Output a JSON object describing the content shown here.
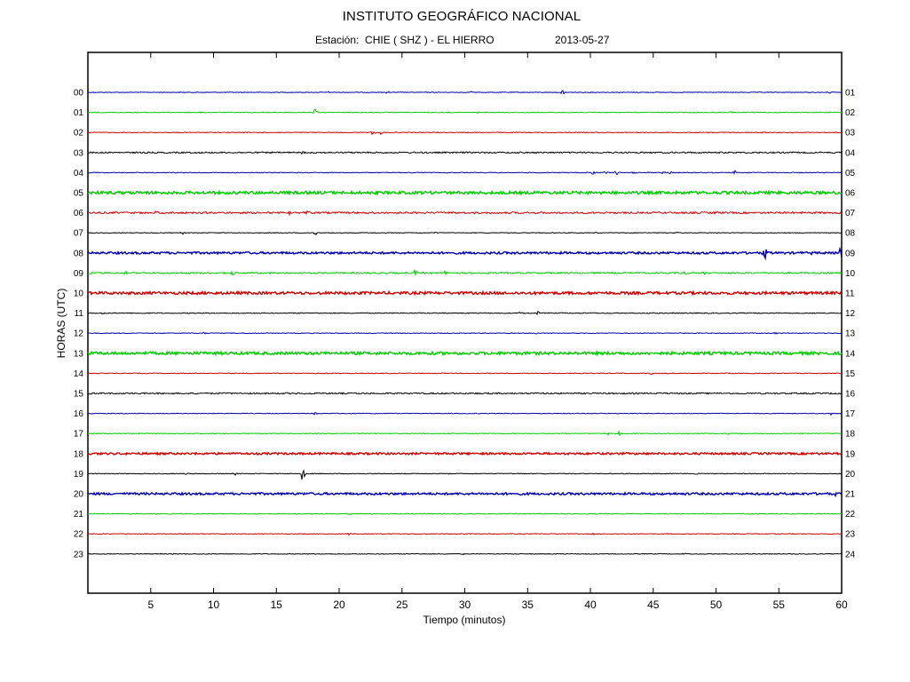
{
  "chart_data": {
    "type": "line",
    "title": "INSTITUTO GEOGRÁFICO NACIONAL",
    "subtitle_station_label": "Estación:",
    "subtitle_station": "CHIE ( SHZ ) - EL HIERRO",
    "subtitle_date": "2013-05-27",
    "xlabel": "Tiempo (minutos)",
    "ylabel": "HORAS (UTC)",
    "xlim": [
      0,
      60
    ],
    "x_ticks": [
      "5",
      "10",
      "15",
      "20",
      "25",
      "30",
      "35",
      "40",
      "45",
      "50",
      "55",
      "60"
    ],
    "grid": false,
    "legend": "none",
    "series": [
      {
        "left_label": "00",
        "right_label": "01",
        "color": "#0000aa",
        "noise": 0.4,
        "events": [
          {
            "t": 37.8,
            "amp": 3
          },
          {
            "t": 19.2,
            "amp": 1.5
          },
          {
            "t": 23.8,
            "amp": 1.5
          },
          {
            "t": 30.5,
            "amp": 1.2
          },
          {
            "t": 59,
            "amp": 1.5
          }
        ]
      },
      {
        "left_label": "01",
        "right_label": "02",
        "color": "#00cc00",
        "noise": 0.4,
        "events": [
          {
            "t": 18.1,
            "amp": 4
          },
          {
            "t": 9.0,
            "amp": 1
          },
          {
            "t": 31.0,
            "amp": 1
          },
          {
            "t": 51.2,
            "amp": 1
          }
        ]
      },
      {
        "left_label": "02",
        "right_label": "03",
        "color": "#cc0000",
        "noise": 0.4,
        "events": [
          {
            "t": 22.7,
            "amp": 4
          },
          {
            "t": 23.3,
            "amp": 2
          },
          {
            "t": 53.8,
            "amp": 1
          }
        ]
      },
      {
        "left_label": "03",
        "right_label": "04",
        "color": "#000000",
        "noise": 0.8,
        "events": [
          {
            "t": 17.1,
            "amp": 2
          }
        ]
      },
      {
        "left_label": "04",
        "right_label": "05",
        "color": "#0000aa",
        "noise": 0.4,
        "events": [
          {
            "t": 40.2,
            "amp": 2.5
          },
          {
            "t": 41.2,
            "amp": 2
          },
          {
            "t": 42.1,
            "amp": 2.5
          },
          {
            "t": 43.5,
            "amp": 2
          },
          {
            "t": 44.8,
            "amp": 2
          },
          {
            "t": 45.9,
            "amp": 2.5
          },
          {
            "t": 46.4,
            "amp": 2
          },
          {
            "t": 51.5,
            "amp": 2
          },
          {
            "t": 58.9,
            "amp": 1.5
          }
        ]
      },
      {
        "left_label": "05",
        "right_label": "06",
        "color": "#00cc00",
        "noise": 1.6,
        "events": []
      },
      {
        "left_label": "06",
        "right_label": "07",
        "color": "#cc0000",
        "noise": 1.0,
        "events": [
          {
            "t": 5.5,
            "amp": 1.5
          },
          {
            "t": 16.0,
            "amp": 1.5
          },
          {
            "t": 17.5,
            "amp": 1.5
          },
          {
            "t": 50.0,
            "amp": 1.5
          }
        ]
      },
      {
        "left_label": "07",
        "right_label": "08",
        "color": "#000000",
        "noise": 0.4,
        "events": [
          {
            "t": 18.1,
            "amp": 3
          },
          {
            "t": 7.5,
            "amp": 1.5
          },
          {
            "t": 27.7,
            "amp": 1.2
          },
          {
            "t": 40.5,
            "amp": 1.2
          },
          {
            "t": 47.0,
            "amp": 1.2
          }
        ]
      },
      {
        "left_label": "08",
        "right_label": "09",
        "color": "#0000aa",
        "noise": 1.2,
        "events": [
          {
            "t": 53.9,
            "amp": 7
          },
          {
            "t": 48.5,
            "amp": 2.5
          },
          {
            "t": 57.5,
            "amp": 2
          },
          {
            "t": 59.95,
            "amp": 8
          }
        ]
      },
      {
        "left_label": "09",
        "right_label": "10",
        "color": "#00cc00",
        "noise": 0.8,
        "events": [
          {
            "t": 3.0,
            "amp": 3
          },
          {
            "t": 11.5,
            "amp": 3
          },
          {
            "t": 26.0,
            "amp": 4
          },
          {
            "t": 28.5,
            "amp": 3
          },
          {
            "t": 47.5,
            "amp": 2.5
          },
          {
            "t": 49.0,
            "amp": 2.5
          }
        ]
      },
      {
        "left_label": "10",
        "right_label": "11",
        "color": "#cc0000",
        "noise": 1.5,
        "events": []
      },
      {
        "left_label": "11",
        "right_label": "12",
        "color": "#000000",
        "noise": 0.5,
        "events": [
          {
            "t": 34.5,
            "amp": 2
          },
          {
            "t": 35.8,
            "amp": 2
          },
          {
            "t": 3.8,
            "amp": 1.5
          },
          {
            "t": 1.2,
            "amp": 1.5
          }
        ]
      },
      {
        "left_label": "12",
        "right_label": "13",
        "color": "#0000aa",
        "noise": 0.4,
        "events": [
          {
            "t": 9.2,
            "amp": 2
          },
          {
            "t": 35.7,
            "amp": 2
          },
          {
            "t": 54.8,
            "amp": 1.5
          }
        ]
      },
      {
        "left_label": "13",
        "right_label": "14",
        "color": "#00cc00",
        "noise": 1.6,
        "events": []
      },
      {
        "left_label": "14",
        "right_label": "15",
        "color": "#cc0000",
        "noise": 0.4,
        "events": [
          {
            "t": 44.8,
            "amp": 2
          }
        ]
      },
      {
        "left_label": "15",
        "right_label": "16",
        "color": "#000000",
        "noise": 0.8,
        "events": []
      },
      {
        "left_label": "16",
        "right_label": "17",
        "color": "#0000aa",
        "noise": 0.4,
        "events": [
          {
            "t": 18.1,
            "amp": 2
          },
          {
            "t": 59.2,
            "amp": 2
          }
        ]
      },
      {
        "left_label": "17",
        "right_label": "18",
        "color": "#00cc00",
        "noise": 0.4,
        "events": [
          {
            "t": 42.3,
            "amp": 2.5
          },
          {
            "t": 41.4,
            "amp": 1.5
          },
          {
            "t": 20.2,
            "amp": 1
          },
          {
            "t": 51.0,
            "amp": 1.5
          }
        ]
      },
      {
        "left_label": "18",
        "right_label": "19",
        "color": "#cc0000",
        "noise": 1.1,
        "events": []
      },
      {
        "left_label": "19",
        "right_label": "20",
        "color": "#000000",
        "noise": 0.4,
        "events": [
          {
            "t": 17.1,
            "amp": 9
          },
          {
            "t": 7.8,
            "amp": 1.5
          },
          {
            "t": 11.7,
            "amp": 1.5
          },
          {
            "t": 48.5,
            "amp": 1.5
          }
        ]
      },
      {
        "left_label": "20",
        "right_label": "21",
        "color": "#0000aa",
        "noise": 1.2,
        "events": [
          {
            "t": 59.5,
            "amp": 2
          }
        ]
      },
      {
        "left_label": "21",
        "right_label": "22",
        "color": "#00cc00",
        "noise": 0.4,
        "events": [
          {
            "t": 20.8,
            "amp": 2
          }
        ]
      },
      {
        "left_label": "22",
        "right_label": "23",
        "color": "#cc0000",
        "noise": 0.4,
        "events": [
          {
            "t": 20.8,
            "amp": 1.5
          },
          {
            "t": 40.3,
            "amp": 2
          }
        ]
      },
      {
        "left_label": "23",
        "right_label": "24",
        "color": "#000000",
        "noise": 0.4,
        "events": [
          {
            "t": 6.8,
            "amp": 1
          },
          {
            "t": 26.2,
            "amp": 1
          },
          {
            "t": 28.0,
            "amp": 1
          },
          {
            "t": 29.8,
            "amp": 1
          },
          {
            "t": 47.5,
            "amp": 1
          },
          {
            "t": 56.0,
            "amp": 1
          }
        ]
      }
    ]
  }
}
